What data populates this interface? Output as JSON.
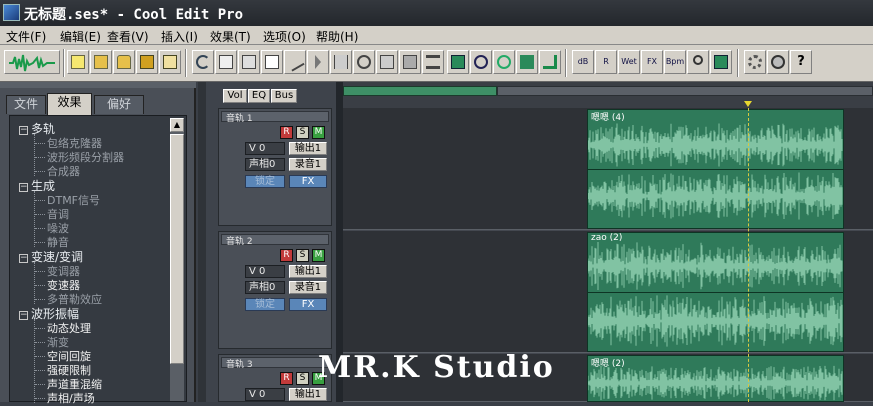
{
  "window": {
    "title": "无标题.ses* - Cool Edit Pro"
  },
  "menu": [
    {
      "label": "文件(F)"
    },
    {
      "label": "编辑(E)"
    },
    {
      "label": "查看(V)"
    },
    {
      "label": "插入(I)"
    },
    {
      "label": "效果(T)"
    },
    {
      "label": "选项(O)"
    },
    {
      "label": "帮助(H)"
    }
  ],
  "toolbar": {
    "buttons": [
      {
        "icon": "waveform-edit-icon",
        "label": ""
      },
      {
        "icon": "new-file-icon"
      },
      {
        "icon": "open-folder-icon"
      },
      {
        "icon": "open-append-icon"
      },
      {
        "icon": "save-icon"
      },
      {
        "icon": "save-all-icon"
      },
      {
        "icon": "undo-icon"
      },
      {
        "icon": "copy-icon"
      },
      {
        "icon": "mix-paste-icon"
      },
      {
        "icon": "insert-icon"
      },
      {
        "icon": "cut-icon"
      },
      {
        "icon": "trim-icon"
      },
      {
        "icon": "split-icon"
      },
      {
        "icon": "loop-icon"
      },
      {
        "icon": "lock-icon"
      },
      {
        "icon": "group-icon"
      },
      {
        "icon": "align-icon"
      },
      {
        "icon": "snap-icon"
      },
      {
        "icon": "envelope-icon"
      },
      {
        "icon": "time-stretch-icon"
      },
      {
        "icon": "pan-icon"
      },
      {
        "icon": "route-icon"
      },
      {
        "icon": "volume-envelope-icon",
        "label": "dB"
      },
      {
        "icon": "pan-envelope-icon",
        "label": "R"
      },
      {
        "icon": "wet-dry-icon",
        "label": "Wet"
      },
      {
        "icon": "fx-icon",
        "label": "FX"
      },
      {
        "icon": "bpm-icon",
        "label": "Bpm"
      },
      {
        "icon": "zoom-cursor-icon"
      },
      {
        "icon": "mixer-icon"
      },
      {
        "icon": "settings-icon"
      },
      {
        "icon": "cd-icon"
      },
      {
        "icon": "help-icon",
        "label": "?"
      }
    ]
  },
  "organizer": {
    "tabs": [
      {
        "label": "文件"
      },
      {
        "label": "效果"
      },
      {
        "label": "偏好"
      }
    ],
    "tree": [
      {
        "label": "多轨",
        "children": [
          "包络克隆器",
          "波形频段分割器",
          "合成器"
        ]
      },
      {
        "label": "生成",
        "children": [
          "DTMF信号",
          "音调",
          "噪波",
          "静音"
        ]
      },
      {
        "label": "变速/变调",
        "children": [
          "变调器",
          "变速器",
          "多普勒效应"
        ]
      },
      {
        "label": "波形振幅",
        "children": [
          "动态处理",
          "渐变",
          "空间回旋",
          "强硬限制",
          "声道重混缩",
          "声相/声场"
        ]
      }
    ]
  },
  "track_view_tabs": [
    {
      "label": "Vol"
    },
    {
      "label": "EQ"
    },
    {
      "label": "Bus"
    }
  ],
  "tracks": [
    {
      "name": "音轨 1",
      "r": "R",
      "s": "S",
      "m": "M",
      "volume": "V 0",
      "output": "输出1",
      "pan": "声相0",
      "record": "录音1",
      "lock": "锁定",
      "fx": "FX",
      "clip_label": "嗯嗯 (4)"
    },
    {
      "name": "音轨 2",
      "r": "R",
      "s": "S",
      "m": "M",
      "volume": "V 0",
      "output": "输出1",
      "pan": "声相0",
      "record": "录音1",
      "lock": "锁定",
      "fx": "FX",
      "clip_label": "zao (2)"
    },
    {
      "name": "音轨 3",
      "r": "R",
      "s": "S",
      "m": "M",
      "volume": "V 0",
      "output": "输出1",
      "clip_label": "嗯嗯 (2)"
    }
  ],
  "watermark": "MR.K Studio",
  "colors": {
    "clip": "#2f7a5a",
    "waveform": "#8fd0b0",
    "playhead": "#e8d830",
    "record": "#c23a3a",
    "solo": "#d0d0c0",
    "mute": "#38a040"
  }
}
